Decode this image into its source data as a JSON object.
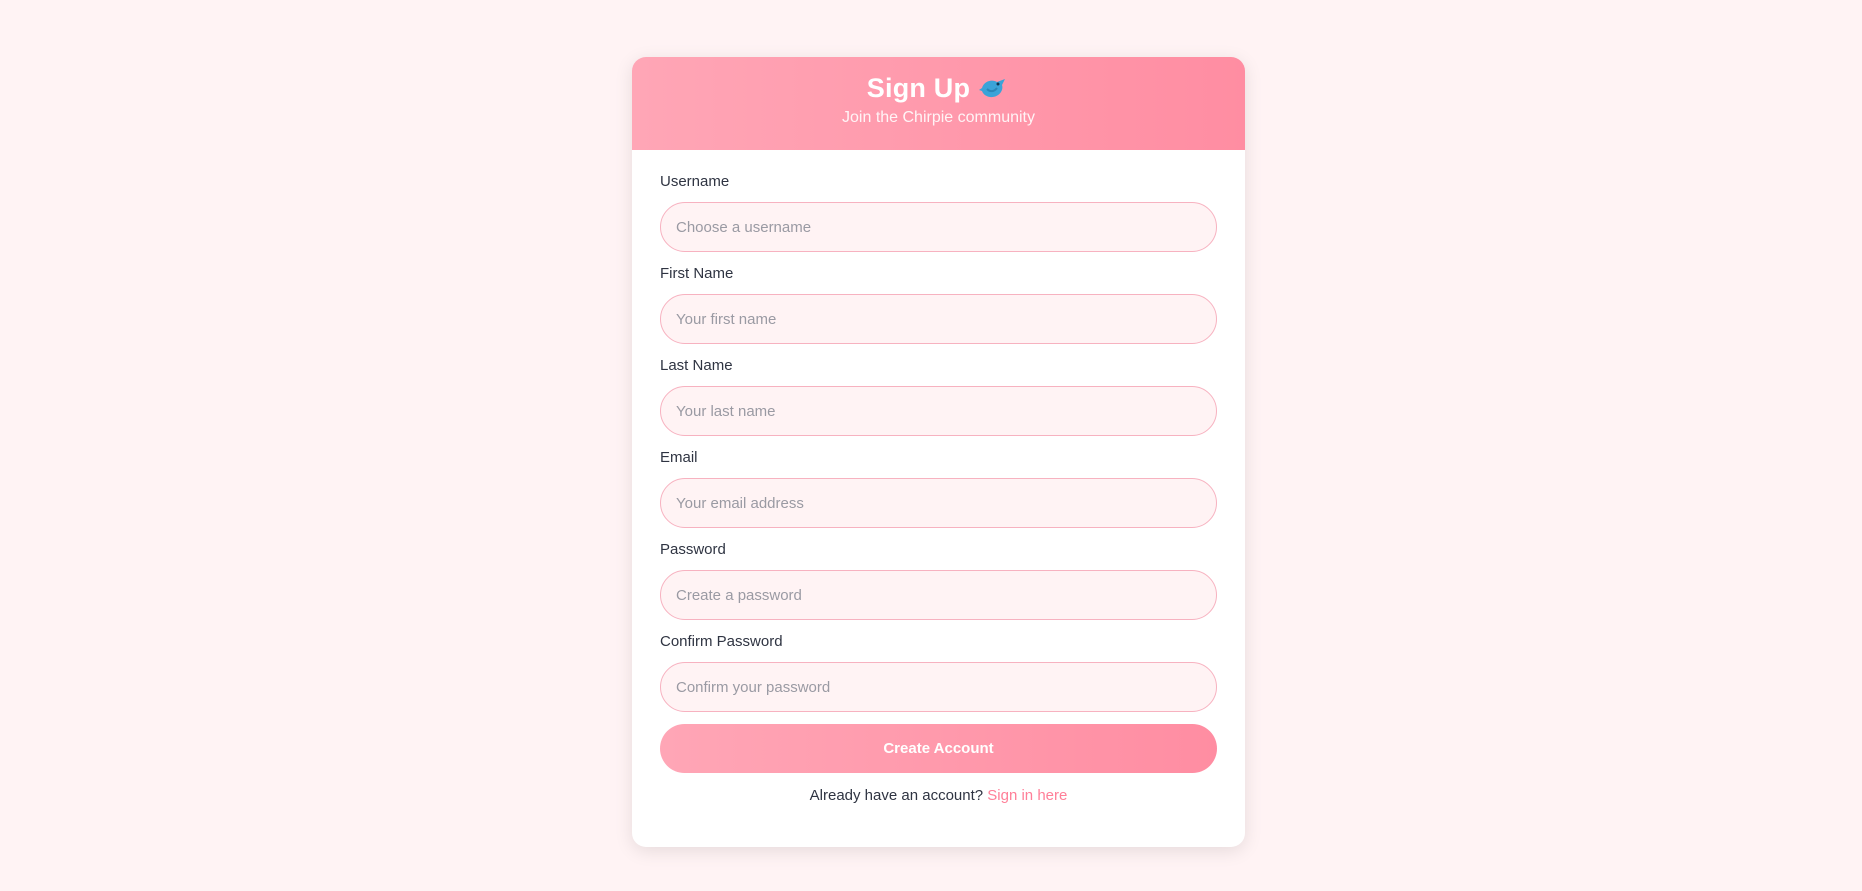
{
  "header": {
    "title": "Sign Up",
    "title_icon": "bird-icon",
    "subtitle": "Join the Chirpie community"
  },
  "form": {
    "fields": [
      {
        "label": "Username",
        "placeholder": "Choose a username",
        "value": ""
      },
      {
        "label": "First Name",
        "placeholder": "Your first name",
        "value": ""
      },
      {
        "label": "Last Name",
        "placeholder": "Your last name",
        "value": ""
      },
      {
        "label": "Email",
        "placeholder": "Your email address",
        "value": ""
      },
      {
        "label": "Password",
        "placeholder": "Create a password",
        "value": ""
      },
      {
        "label": "Confirm Password",
        "placeholder": "Confirm your password",
        "value": ""
      }
    ],
    "submit_label": "Create Account"
  },
  "footer": {
    "prompt": "Already have an account?",
    "link_label": "Sign in here"
  },
  "colors": {
    "page_background": "#fff3f4",
    "accent_start": "#ffa6b6",
    "accent_end": "#ff8da2",
    "link": "#ff7f98",
    "input_border": "#f7b2c0",
    "bird": "#3aa3d8"
  }
}
